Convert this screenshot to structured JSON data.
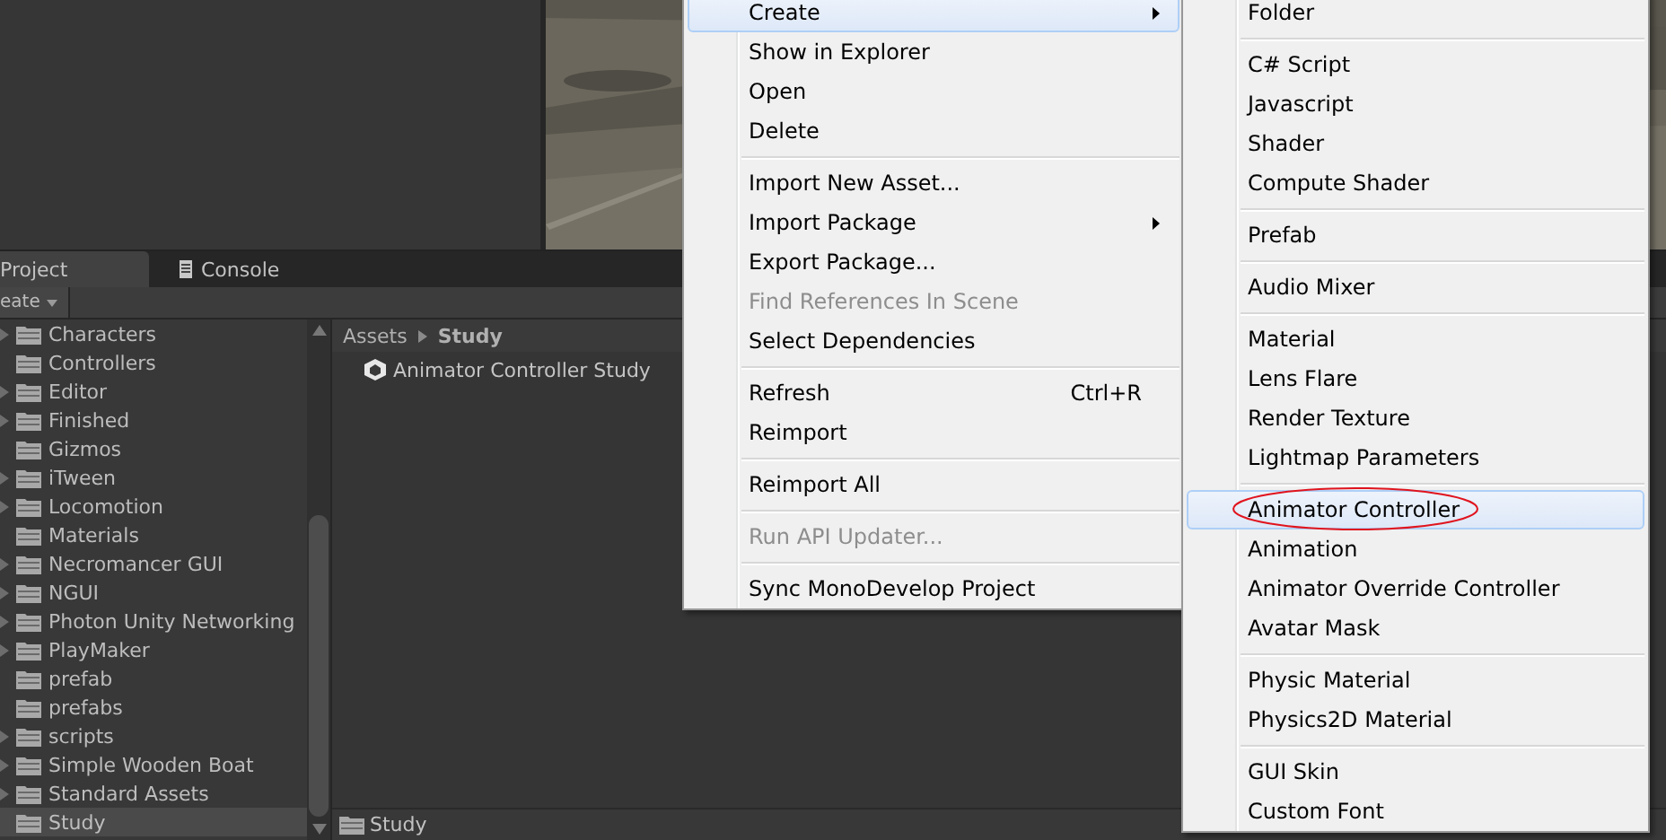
{
  "project_panel": {
    "tabs": [
      {
        "label": "Project",
        "selected": true,
        "kind": "plain"
      },
      {
        "label": "Console",
        "selected": false,
        "kind": "console"
      }
    ],
    "toolbar": {
      "create_button": "eate"
    },
    "folders": [
      {
        "name": "Characters",
        "has_children": true,
        "selected": false
      },
      {
        "name": "Controllers",
        "has_children": false,
        "selected": false
      },
      {
        "name": "Editor",
        "has_children": true,
        "selected": false
      },
      {
        "name": "Finished",
        "has_children": true,
        "selected": false
      },
      {
        "name": "Gizmos",
        "has_children": false,
        "selected": false
      },
      {
        "name": "iTween",
        "has_children": true,
        "selected": false
      },
      {
        "name": "Locomotion",
        "has_children": true,
        "selected": false
      },
      {
        "name": "Materials",
        "has_children": false,
        "selected": false
      },
      {
        "name": "Necromancer GUI",
        "has_children": true,
        "selected": false
      },
      {
        "name": "NGUI",
        "has_children": true,
        "selected": false
      },
      {
        "name": "Photon Unity Networking",
        "has_children": true,
        "selected": false
      },
      {
        "name": "PlayMaker",
        "has_children": true,
        "selected": false
      },
      {
        "name": "prefab",
        "has_children": false,
        "selected": false
      },
      {
        "name": "prefabs",
        "has_children": false,
        "selected": false
      },
      {
        "name": "scripts",
        "has_children": true,
        "selected": false
      },
      {
        "name": "Simple Wooden Boat",
        "has_children": true,
        "selected": false
      },
      {
        "name": "Standard Assets",
        "has_children": true,
        "selected": false
      },
      {
        "name": "Study",
        "has_children": false,
        "selected": true
      }
    ],
    "breadcrumb": [
      "Assets",
      "Study"
    ],
    "assets": [
      {
        "name": "Animator Controller Study"
      }
    ],
    "path_bar": "Study"
  },
  "menus": [
    {
      "groups": [
        [
          {
            "label": "Create",
            "submenu": true,
            "disabled": false,
            "selected": true
          },
          {
            "label": "Show in Explorer",
            "disabled": false,
            "selected": false
          },
          {
            "label": "Open",
            "disabled": false,
            "selected": false
          },
          {
            "label": "Delete",
            "disabled": false,
            "selected": false
          }
        ],
        [
          {
            "label": "Import New Asset...",
            "disabled": false,
            "selected": false
          },
          {
            "label": "Import Package",
            "submenu": true,
            "disabled": false,
            "selected": false
          },
          {
            "label": "Export Package...",
            "disabled": false,
            "selected": false
          },
          {
            "label": "Find References In Scene",
            "disabled": true,
            "selected": false
          },
          {
            "label": "Select Dependencies",
            "disabled": false,
            "selected": false
          }
        ],
        [
          {
            "label": "Refresh",
            "shortcut": "Ctrl+R",
            "disabled": false,
            "selected": false
          },
          {
            "label": "Reimport",
            "disabled": false,
            "selected": false
          }
        ],
        [
          {
            "label": "Reimport All",
            "disabled": false,
            "selected": false
          }
        ],
        [
          {
            "label": "Run API Updater...",
            "disabled": true,
            "selected": false
          }
        ],
        [
          {
            "label": "Sync MonoDevelop Project",
            "disabled": false,
            "selected": false
          }
        ]
      ]
    },
    {
      "groups": [
        [
          {
            "label": "Folder",
            "disabled": false,
            "selected": false
          }
        ],
        [
          {
            "label": "C# Script",
            "disabled": false,
            "selected": false
          },
          {
            "label": "Javascript",
            "disabled": false,
            "selected": false
          },
          {
            "label": "Shader",
            "disabled": false,
            "selected": false
          },
          {
            "label": "Compute Shader",
            "disabled": false,
            "selected": false
          }
        ],
        [
          {
            "label": "Prefab",
            "disabled": false,
            "selected": false
          }
        ],
        [
          {
            "label": "Audio Mixer",
            "disabled": false,
            "selected": false
          }
        ],
        [
          {
            "label": "Material",
            "disabled": false,
            "selected": false
          },
          {
            "label": "Lens Flare",
            "disabled": false,
            "selected": false
          },
          {
            "label": "Render Texture",
            "disabled": false,
            "selected": false
          },
          {
            "label": "Lightmap Parameters",
            "disabled": false,
            "selected": false
          }
        ],
        [
          {
            "label": "Animator Controller",
            "disabled": false,
            "selected": true,
            "circled": true
          },
          {
            "label": "Animation",
            "disabled": false,
            "selected": false
          },
          {
            "label": "Animator Override Controller",
            "disabled": false,
            "selected": false
          },
          {
            "label": "Avatar Mask",
            "disabled": false,
            "selected": false
          }
        ],
        [
          {
            "label": "Physic Material",
            "disabled": false,
            "selected": false
          },
          {
            "label": "Physics2D Material",
            "disabled": false,
            "selected": false
          }
        ],
        [
          {
            "label": "GUI Skin",
            "disabled": false,
            "selected": false
          },
          {
            "label": "Custom Font",
            "disabled": false,
            "selected": false
          }
        ]
      ]
    }
  ]
}
